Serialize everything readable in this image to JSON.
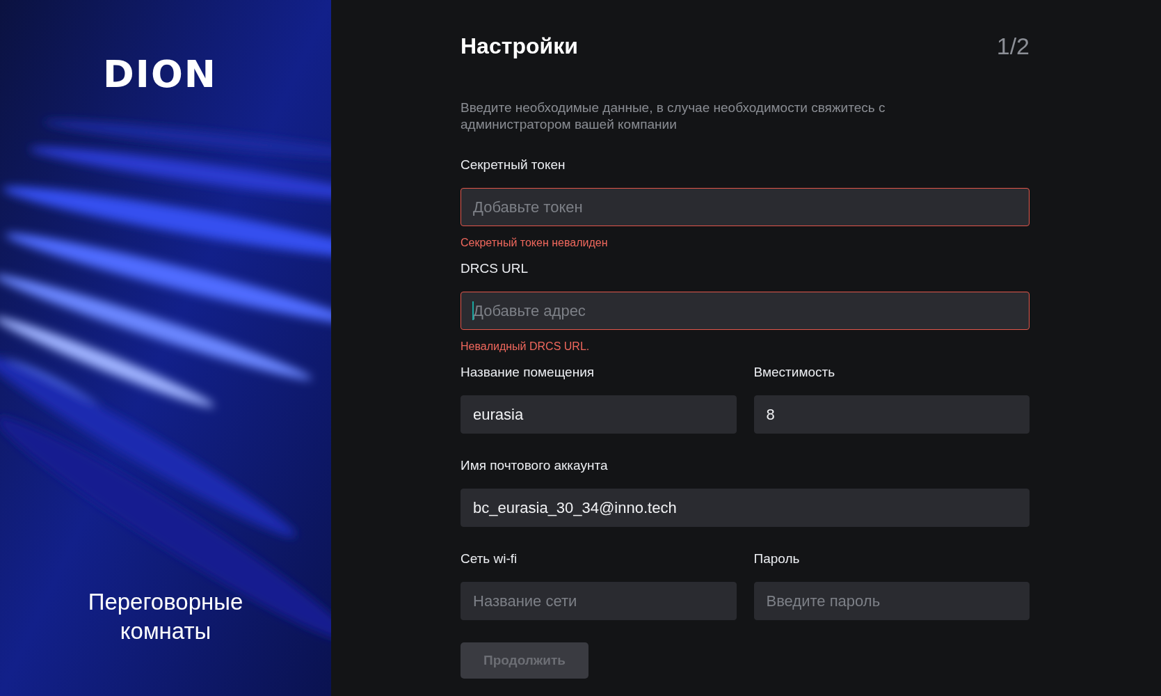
{
  "side": {
    "logo": "DION",
    "caption": "Переговорные комнаты"
  },
  "header": {
    "title": "Настройки",
    "step": "1/2"
  },
  "description": "Введите необходимые данные, в случае необходимости свяжитесь с администратором вашей компании",
  "rows": [
    [
      {
        "label": "Секретный токен",
        "placeholder": "Добавьте токен",
        "invalid": true,
        "focused": false,
        "error": "Секретный токен невалиден"
      }
    ],
    [
      {
        "label": "DRCS URL",
        "placeholder": "Добавьте адрес",
        "invalid": true,
        "focused": true,
        "error": "Невалидный DRCS URL."
      }
    ],
    [
      {
        "label": "Название помещения",
        "value": "eurasia",
        "invalid": false,
        "focused": false
      },
      {
        "label": "Вместимость",
        "value": "8",
        "invalid": false,
        "focused": false
      }
    ],
    [
      {
        "label": "Имя почтового аккаунта",
        "value": "bc_eurasia_30_34@inno.tech",
        "invalid": false,
        "focused": false
      }
    ],
    [
      {
        "label": "Сеть wi-fi",
        "placeholder": "Название сети",
        "invalid": false,
        "focused": false
      },
      {
        "label": "Пароль",
        "placeholder": "Введите пароль",
        "invalid": false,
        "focused": false
      }
    ]
  ],
  "button": {
    "label": "Продолжить",
    "disabled": true
  }
}
